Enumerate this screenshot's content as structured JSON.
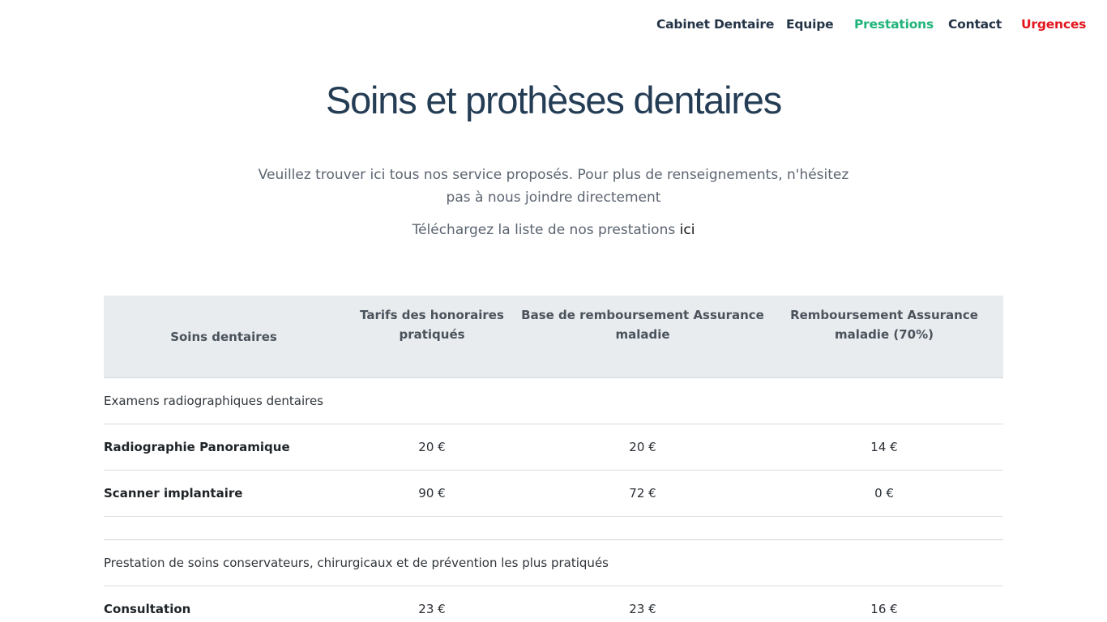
{
  "nav": {
    "items": [
      {
        "label": "Cabinet Dentaire"
      },
      {
        "label": "Equipe"
      },
      {
        "label": "Prestations"
      },
      {
        "label": "Contact"
      },
      {
        "label": "Urgences"
      }
    ]
  },
  "page": {
    "title": "Soins et prothèses dentaires",
    "intro": "Veuillez trouver ici tous nos service proposés. Pour plus de renseignements, n'hésitez pas à nous joindre directement",
    "download_text": "Téléchargez la liste de nos prestations",
    "download_link": "ici"
  },
  "table": {
    "headers": [
      "Soins dentaires",
      "Tarifs des honoraires pratiqués",
      "Base de remboursement Assurance maladie",
      "Remboursement Assurance maladie (70%)"
    ],
    "sections": [
      {
        "title": "Examens radiographiques dentaires",
        "rows": [
          {
            "name": "Radiographie Panoramique",
            "tarif": "20 €",
            "base": "20 €",
            "remb": "14 €"
          },
          {
            "name": "Scanner implantaire",
            "tarif": "90 €",
            "base": "72 €",
            "remb": "0 €"
          }
        ]
      },
      {
        "title": "Prestation de soins conservateurs, chirurgicaux et de prévention les plus pratiqués",
        "rows": [
          {
            "name": "Consultation",
            "tarif": "23 €",
            "base": "23 €",
            "remb": "16 €"
          }
        ]
      }
    ]
  }
}
